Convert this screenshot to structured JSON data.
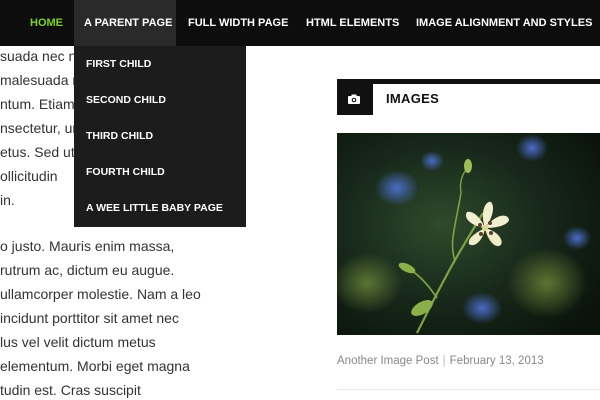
{
  "nav": {
    "items": [
      {
        "label": "HOME"
      },
      {
        "label": "A PARENT PAGE"
      },
      {
        "label": "FULL WIDTH PAGE"
      },
      {
        "label": "HTML ELEMENTS"
      },
      {
        "label": "IMAGE ALIGNMENT AND STYLES"
      }
    ],
    "dropdown": [
      {
        "label": "FIRST CHILD"
      },
      {
        "label": "SECOND CHILD"
      },
      {
        "label": "THIRD CHILD"
      },
      {
        "label": "FOURTH CHILD"
      },
      {
        "label": "A WEE LITTLE BABY PAGE"
      }
    ]
  },
  "body_text": {
    "lines": [
      "suada nec nunc. Praesent",
      "malesuada mi vulputate a. Sed",
      "ntum. Etiam",
      "nsectetur, urna vel commodo",
      "etus. Sed ut metus tempor",
      "ollicitudin",
      "in.",
      "o justo. Mauris enim massa,",
      " rutrum ac, dictum eu augue.",
      " ullamcorper molestie. Nam a leo",
      " incidunt porttitor sit amet nec",
      "lus vel velit dictum metus",
      "elementum. Morbi eget magna",
      "tudin est. Cras suscipit"
    ]
  },
  "widget": {
    "title": "IMAGES",
    "icon": "camera-icon",
    "post_title": "Another Image Post",
    "post_date": "February 13, 2013"
  },
  "colors": {
    "nav_bg": "#0d0d0d",
    "home_accent": "#7ed321",
    "dropdown_bg": "#1c1c1c",
    "meta_text": "#888888"
  }
}
